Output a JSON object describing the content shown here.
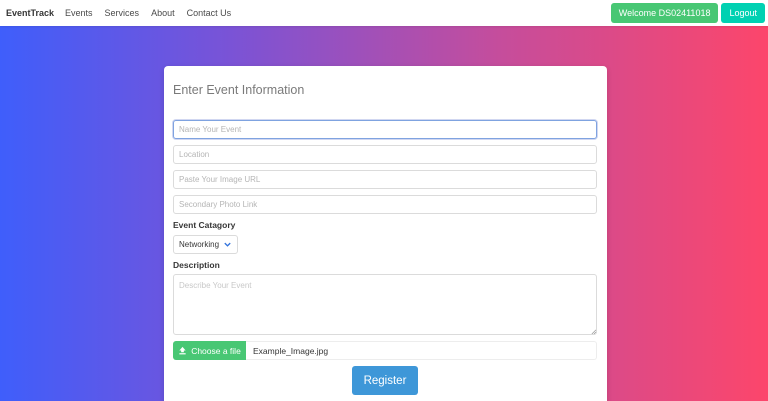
{
  "nav": {
    "brand": "EventTrack",
    "links": [
      "Events",
      "Services",
      "About",
      "Contact Us"
    ],
    "welcome_label": "Welcome DS02411018",
    "logout_label": "Logout"
  },
  "form": {
    "title": "Enter Event Information",
    "name_placeholder": "Name Your Event",
    "location_placeholder": "Location",
    "image_url_placeholder": "Paste Your Image URL",
    "secondary_photo_placeholder": "Secondary Photo Link",
    "category_label": "Event Catagory",
    "category_selected": "Networking",
    "description_label": "Description",
    "description_placeholder": "Describe Your Event",
    "file_button_label": "Choose a file",
    "file_name": "Example_Image.jpg",
    "register_label": "Register"
  },
  "colors": {
    "gradient_start": "#3f5efb",
    "gradient_end": "#fc466b",
    "success_green": "#48c774",
    "teal": "#00d1b2",
    "register_blue": "#3e97d8"
  },
  "icons": {
    "chevron": "chevron-down-icon",
    "upload": "upload-icon"
  }
}
